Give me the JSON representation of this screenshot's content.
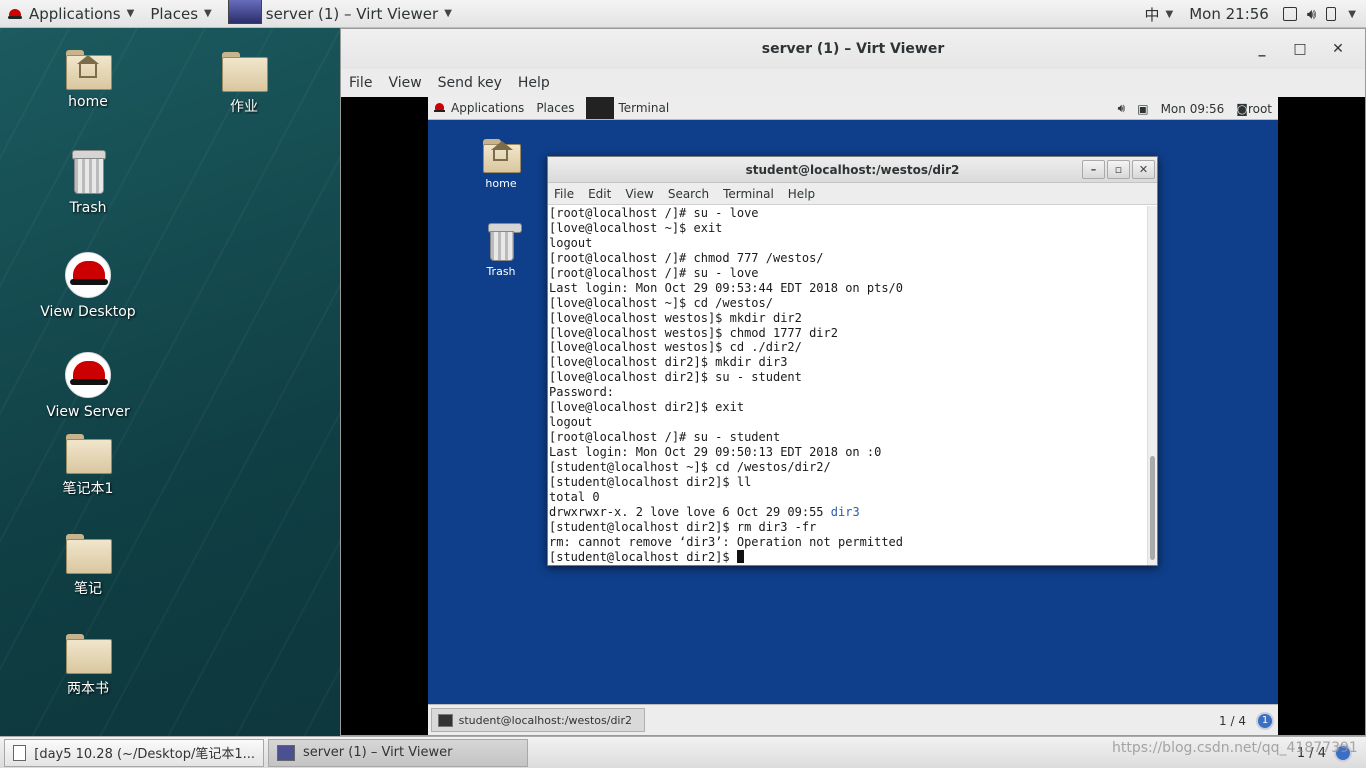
{
  "host": {
    "topbar": {
      "applications": "Applications",
      "places": "Places",
      "window_title": "server (1) – Virt Viewer",
      "input_method": "中",
      "clock": "Mon 21:56"
    },
    "desktop_icons": [
      {
        "label": "home"
      },
      {
        "label": "作业"
      },
      {
        "label": "Trash"
      },
      {
        "label": "View Desktop"
      },
      {
        "label": "View Server"
      },
      {
        "label": "笔记本1"
      },
      {
        "label": "笔记"
      },
      {
        "label": "两本书"
      }
    ],
    "taskbar": {
      "tasks": [
        {
          "label": "[day5 10.28 (~/Desktop/笔记本1..."
        },
        {
          "label": "server (1) – Virt Viewer"
        }
      ],
      "pager": "1 / 4"
    },
    "watermark": "https://blog.csdn.net/qq_41877391"
  },
  "virt_viewer": {
    "title": "server (1) – Virt Viewer",
    "controls": {
      "minimize": "_",
      "maximize": "□",
      "close": "✕"
    },
    "menu": [
      "File",
      "View",
      "Send key",
      "Help"
    ]
  },
  "guest": {
    "topbar": {
      "applications": "Applications",
      "places": "Places",
      "terminal": "Terminal",
      "clock": "Mon 09:56",
      "user": "root"
    },
    "desktop_icons": [
      {
        "label": "home"
      },
      {
        "label": "Trash"
      }
    ],
    "terminal": {
      "title": "student@localhost:/westos/dir2",
      "menu": [
        "File",
        "Edit",
        "View",
        "Search",
        "Terminal",
        "Help"
      ],
      "lines": [
        "[root@localhost /]# su - love",
        "[love@localhost ~]$ exit",
        "logout",
        "[root@localhost /]# chmod 777 /westos/",
        "[root@localhost /]# su - love",
        "Last login: Mon Oct 29 09:53:44 EDT 2018 on pts/0",
        "[love@localhost ~]$ cd /westos/",
        "[love@localhost westos]$ mkdir dir2",
        "[love@localhost westos]$ chmod 1777 dir2",
        "[love@localhost westos]$ cd ./dir2/",
        "[love@localhost dir2]$ mkdir dir3",
        "[love@localhost dir2]$ su - student",
        "Password:",
        "[love@localhost dir2]$ exit",
        "logout",
        "[root@localhost /]# su - student",
        "Last login: Mon Oct 29 09:50:13 EDT 2018 on :0",
        "[student@localhost ~]$ cd /westos/dir2/",
        "[student@localhost dir2]$ ll",
        "total 0",
        "drwxrwxr-x. 2 love love 6 Oct 29 09:55 ",
        "[student@localhost dir2]$ rm dir3 -fr",
        "rm: cannot remove ‘dir3’: Operation not permitted",
        "[student@localhost dir2]$ "
      ],
      "ls_dir_name": "dir3"
    },
    "taskbar": {
      "task": "student@localhost:/westos/dir2",
      "pager": "1 / 4",
      "pager_dot": "1"
    }
  }
}
